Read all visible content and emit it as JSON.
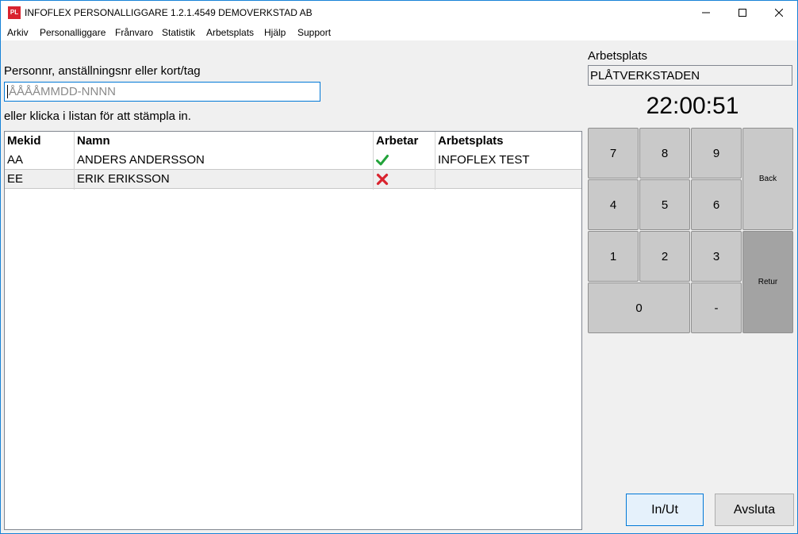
{
  "window": {
    "app_icon_text": "PL",
    "title": "INFOFLEX PERSONALLIGGARE 1.2.1.4549 DEMOVERKSTAD AB"
  },
  "menu": {
    "arkiv": "Arkiv",
    "personalliggare": "Personalliggare",
    "franvaro": "Frånvaro",
    "statistik": "Statistik",
    "arbetsplats": "Arbetsplats",
    "hjalp": "Hjälp",
    "support": "Support"
  },
  "main": {
    "id_label": "Personnr, anställningsnr eller kort/tag",
    "id_value": "",
    "id_placeholder": "ÅÅÅÅMMDD-NNNN",
    "list_hint": "eller klicka i listan för att stämpla in."
  },
  "table": {
    "columns": [
      "Mekid",
      "Namn",
      "Arbetar",
      "Arbetsplats"
    ],
    "rows": [
      {
        "mekid": "AA",
        "namn": "ANDERS ANDERSSON",
        "arbetar": "check",
        "arbetsplats": "INFOFLEX TEST"
      },
      {
        "mekid": "EE",
        "namn": "ERIK ERIKSSON",
        "arbetar": "cross",
        "arbetsplats": ""
      }
    ]
  },
  "workplace": {
    "label": "Arbetsplats",
    "value": "PLÅTVERKSTADEN"
  },
  "clock": "22:00:51",
  "keypad": {
    "k7": "7",
    "k8": "8",
    "k9": "9",
    "back": "Back",
    "k4": "4",
    "k5": "5",
    "k6": "6",
    "k1": "1",
    "k2": "2",
    "k3": "3",
    "retur": "Retur",
    "k0": "0",
    "dash": "-"
  },
  "buttons": {
    "in_ut": "In/Ut",
    "avsluta": "Avsluta"
  },
  "colors": {
    "accent": "#0078d7",
    "check": "#22a33a",
    "cross": "#d9232e"
  }
}
